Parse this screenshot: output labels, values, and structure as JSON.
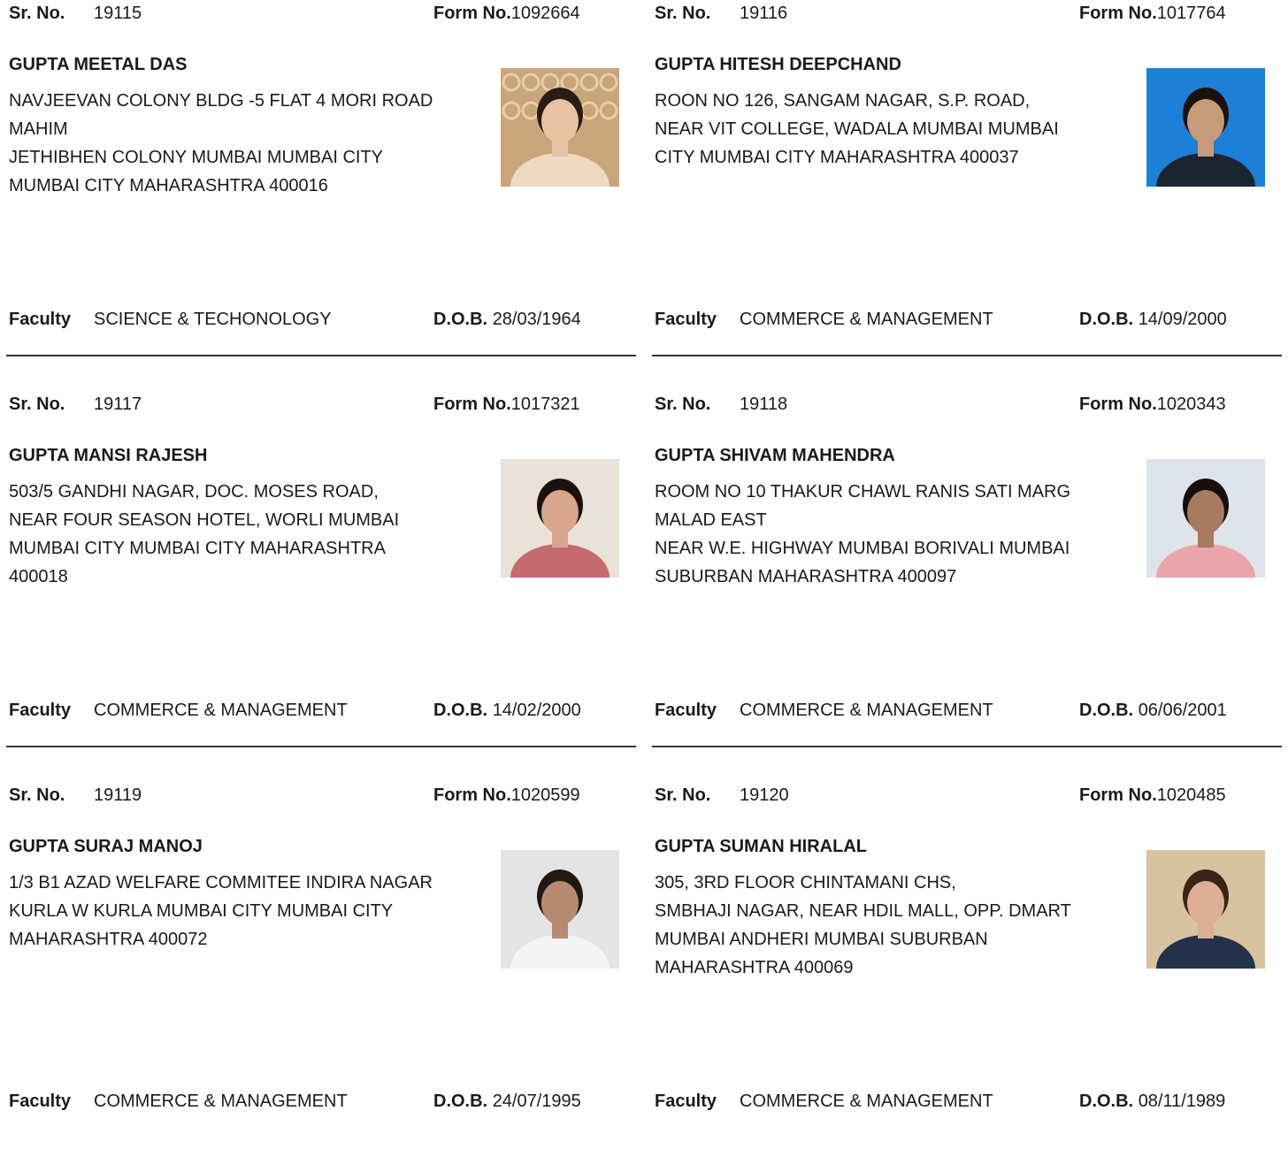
{
  "labels": {
    "sr_no": "Sr. No.",
    "form_no": "Form No.",
    "faculty": "Faculty",
    "dob": "D.O.B."
  },
  "records": [
    {
      "sr_no": "19115",
      "form_no": "1092664",
      "name": "GUPTA MEETAL DAS",
      "address_lines": [
        "NAVJEEVAN COLONY BLDG -5 FLAT 4 MORI ROAD",
        "MAHIM",
        "JETHIBHEN COLONY MUMBAI MUMBAI CITY",
        "MUMBAI CITY MAHARASHTRA 400016"
      ],
      "faculty": "SCIENCE & TECHONOLOGY",
      "dob": "28/03/1964",
      "photo": {
        "bg": "#c9a57a",
        "skin": "#e7c3a6",
        "hair": "#2a1b14",
        "shirt": "#f0d9c2",
        "pattern": true
      }
    },
    {
      "sr_no": "19116",
      "form_no": "1017764",
      "name": "GUPTA HITESH DEEPCHAND",
      "address_lines": [
        "ROON NO 126, SANGAM NAGAR, S.P. ROAD,",
        "NEAR VIT COLLEGE, WADALA MUMBAI MUMBAI",
        "CITY MUMBAI CITY MAHARASHTRA 400037"
      ],
      "faculty": "COMMERCE & MANAGEMENT",
      "dob": "14/09/2000",
      "photo": {
        "bg": "#1e7fd6",
        "skin": "#c79a7a",
        "hair": "#1a120d",
        "shirt": "#1c2430",
        "pattern": false
      }
    },
    {
      "sr_no": "19117",
      "form_no": "1017321",
      "name": "GUPTA MANSI RAJESH",
      "address_lines": [
        "503/5 GANDHI NAGAR, DOC. MOSES ROAD,",
        "NEAR FOUR SEASON HOTEL, WORLI MUMBAI",
        "MUMBAI CITY MUMBAI CITY MAHARASHTRA",
        "400018"
      ],
      "faculty": "COMMERCE & MANAGEMENT",
      "dob": "14/02/2000",
      "photo": {
        "bg": "#e9e2d8",
        "skin": "#d9a58c",
        "hair": "#1b120e",
        "shirt": "#c56b6e",
        "pattern": false
      }
    },
    {
      "sr_no": "19118",
      "form_no": "1020343",
      "name": "GUPTA SHIVAM MAHENDRA",
      "address_lines": [
        "ROOM NO 10 THAKUR CHAWL RANIS SATI MARG",
        "MALAD EAST",
        "NEAR W.E. HIGHWAY MUMBAI BORIVALI MUMBAI",
        "SUBURBAN MAHARASHTRA 400097"
      ],
      "faculty": "COMMERCE & MANAGEMENT",
      "dob": "06/06/2001",
      "photo": {
        "bg": "#dfe3ea",
        "skin": "#a87a5f",
        "hair": "#15100d",
        "shirt": "#e8a5aa",
        "pattern": false
      }
    },
    {
      "sr_no": "19119",
      "form_no": "1020599",
      "name": "GUPTA SURAJ MANOJ",
      "address_lines": [
        "1/3 B1 AZAD WELFARE COMMITEE INDIRA NAGAR",
        "KURLA W KURLA MUMBAI CITY MUMBAI CITY",
        "MAHARASHTRA 400072"
      ],
      "faculty": "COMMERCE & MANAGEMENT",
      "dob": "24/07/1995",
      "photo": {
        "bg": "#e4e4e4",
        "skin": "#b58c72",
        "hair": "#211814",
        "shirt": "#f4f4f4",
        "pattern": false
      }
    },
    {
      "sr_no": "19120",
      "form_no": "1020485",
      "name": "GUPTA SUMAN HIRALAL",
      "address_lines": [
        "305, 3RD FLOOR CHINTAMANI  CHS,",
        "SMBHAJI NAGAR, NEAR HDIL MALL, OPP. DMART",
        "MUMBAI ANDHERI MUMBAI SUBURBAN",
        "MAHARASHTRA 400069"
      ],
      "faculty": "COMMERCE & MANAGEMENT",
      "dob": "08/11/1989",
      "photo": {
        "bg": "#d8c2a0",
        "skin": "#dcae94",
        "hair": "#3a2418",
        "shirt": "#23324a",
        "pattern": false
      }
    }
  ]
}
